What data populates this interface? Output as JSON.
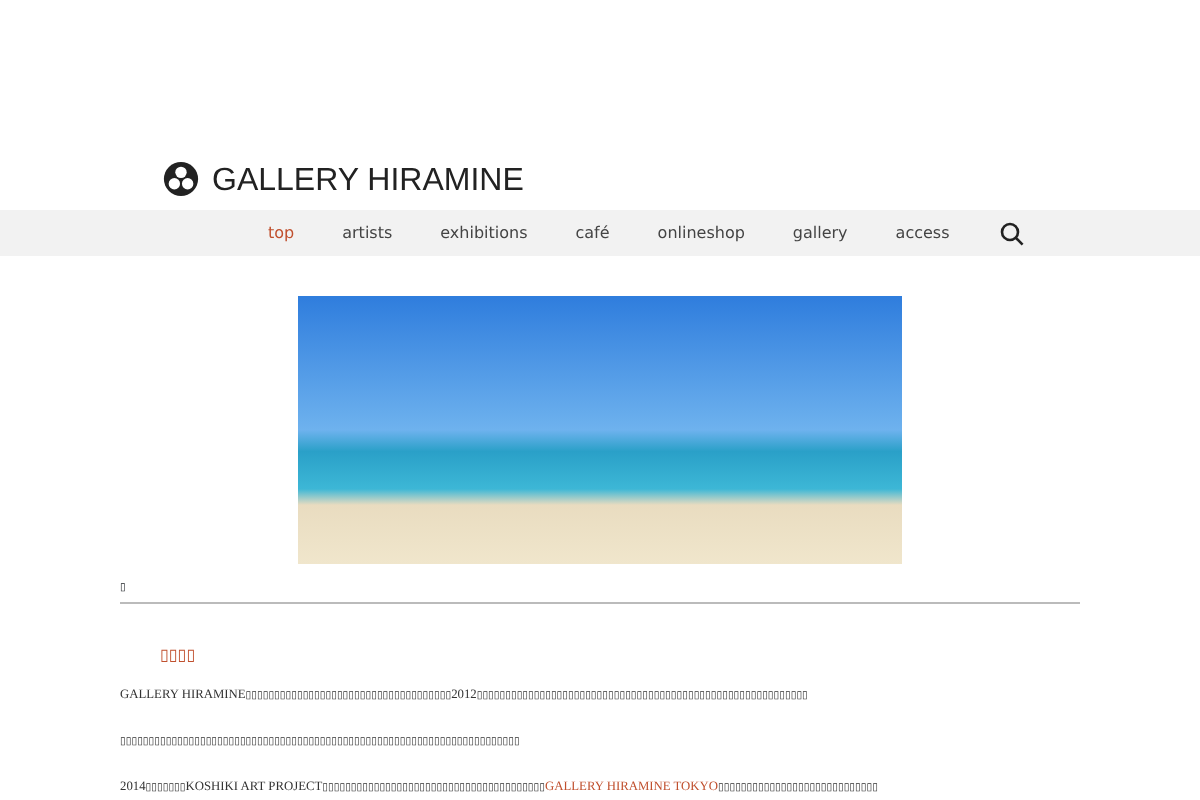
{
  "site": {
    "title": "GALLERY HIRAMINE"
  },
  "nav": [
    {
      "label": "top",
      "selected": true
    },
    {
      "label": "artists",
      "selected": false
    },
    {
      "label": "exhibitions",
      "selected": false
    },
    {
      "label": "café",
      "selected": false
    },
    {
      "label": "onlineshop",
      "selected": false
    },
    {
      "label": "gallery",
      "selected": false
    },
    {
      "label": "access",
      "selected": false
    }
  ],
  "section_heading": "▯",
  "article": {
    "heading": "▯▯▯▯",
    "paragraphs": [
      [
        {
          "text": "GALLERY HIRAMINE▯▯▯▯▯▯▯▯▯▯▯▯▯▯▯▯▯▯▯▯▯▯▯▯▯▯▯▯▯▯▯▯▯▯▯▯2012▯▯▯▯▯▯▯▯▯▯▯▯▯▯▯▯▯▯▯▯▯▯▯▯▯▯▯▯▯▯▯▯▯▯▯▯▯▯▯▯▯▯▯▯▯▯▯▯▯▯▯▯▯▯▯▯▯▯",
          "link": false
        }
      ],
      [
        {
          "text": "▯▯▯▯▯▯▯▯▯▯▯▯▯▯▯▯▯▯▯▯▯▯▯▯▯▯▯▯▯▯▯▯▯▯▯▯▯▯▯▯▯▯▯▯▯▯▯▯▯▯▯▯▯▯▯▯▯▯▯▯▯▯▯▯▯▯▯▯▯▯",
          "link": false
        }
      ],
      [
        {
          "text": "2014▯▯▯▯▯▯▯KOSHIKI ART PROJECT▯▯▯▯▯▯▯▯▯▯▯▯▯▯▯▯▯▯▯▯▯▯▯▯▯▯▯▯▯▯▯▯▯▯▯▯▯▯▯",
          "link": false
        },
        {
          "text": "GALLERY HIRAMINE TOKYO",
          "link": true
        },
        {
          "text": "▯▯▯▯▯▯▯▯▯▯▯▯▯▯▯▯▯▯▯▯▯▯▯▯▯▯▯▯",
          "link": false
        }
      ]
    ]
  }
}
